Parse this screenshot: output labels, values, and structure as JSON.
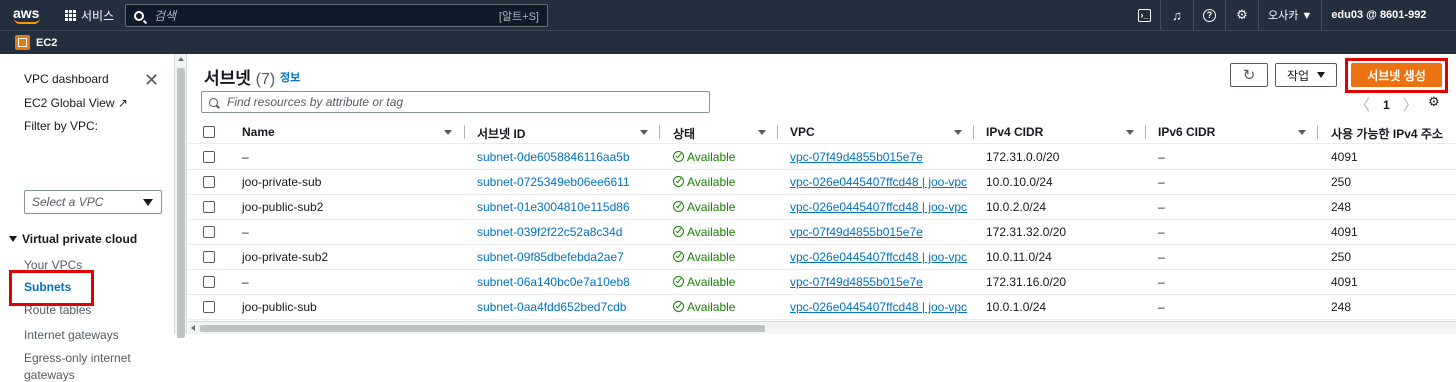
{
  "topbar": {
    "logo_text": "aws",
    "services_label": "서비스",
    "search_placeholder": "검색",
    "search_shortcut": "[알트+S]",
    "region": "오사카 ▼",
    "account": "edu03 @ 8601-992"
  },
  "service_bar": {
    "label": "EC2"
  },
  "sidebar": {
    "items_top": [
      "VPC dashboard",
      "EC2 Global View ↗"
    ],
    "filter_label": "Filter by VPC:",
    "filter_placeholder": "Select a VPC",
    "section_title": "Virtual private cloud",
    "items": [
      "Your VPCs",
      "Subnets",
      "Route tables",
      "Internet gateways",
      "Egress-only internet",
      "gateways"
    ]
  },
  "header": {
    "title": "서브넷",
    "count": "(7)",
    "info": "정보",
    "actions_label": "작업",
    "create_label": "서브넷 생성",
    "search_placeholder": "Find resources by attribute or tag",
    "page": "1"
  },
  "table": {
    "columns": [
      "Name",
      "서브넷 ID",
      "상태",
      "VPC",
      "IPv4 CIDR",
      "IPv6 CIDR",
      "사용 가능한 IPv4 주소"
    ],
    "rows": [
      {
        "name": "–",
        "id": "subnet-0de6058846116aa5b",
        "state": "Available",
        "vpc": "vpc-07f49d4855b015e7e",
        "ipv4": "172.31.0.0/20",
        "ipv6": "–",
        "avail": "4091"
      },
      {
        "name": "joo-private-sub",
        "id": "subnet-0725349eb06ee6611",
        "state": "Available",
        "vpc": "vpc-026e0445407ffcd48 | joo-vpc",
        "ipv4": "10.0.10.0/24",
        "ipv6": "–",
        "avail": "250"
      },
      {
        "name": "joo-public-sub2",
        "id": "subnet-01e3004810e115d86",
        "state": "Available",
        "vpc": "vpc-026e0445407ffcd48 | joo-vpc",
        "ipv4": "10.0.2.0/24",
        "ipv6": "–",
        "avail": "248"
      },
      {
        "name": "–",
        "id": "subnet-039f2f22c52a8c34d",
        "state": "Available",
        "vpc": "vpc-07f49d4855b015e7e",
        "ipv4": "172.31.32.0/20",
        "ipv6": "–",
        "avail": "4091"
      },
      {
        "name": "joo-private-sub2",
        "id": "subnet-09f85dbefebda2ae7",
        "state": "Available",
        "vpc": "vpc-026e0445407ffcd48 | joo-vpc",
        "ipv4": "10.0.11.0/24",
        "ipv6": "–",
        "avail": "250"
      },
      {
        "name": "–",
        "id": "subnet-06a140bc0e7a10eb8",
        "state": "Available",
        "vpc": "vpc-07f49d4855b015e7e",
        "ipv4": "172.31.16.0/20",
        "ipv6": "–",
        "avail": "4091"
      },
      {
        "name": "joo-public-sub",
        "id": "subnet-0aa4fdd652bed7cdb",
        "state": "Available",
        "vpc": "vpc-026e0445407ffcd48 | joo-vpc",
        "ipv4": "10.0.1.0/24",
        "ipv6": "–",
        "avail": "248"
      }
    ]
  },
  "colors": {
    "topbar": "#232f3e",
    "accent_orange": "#ec7211",
    "link_blue": "#0073bb",
    "status_green": "#1d8102",
    "highlight_red": "#e00000"
  }
}
